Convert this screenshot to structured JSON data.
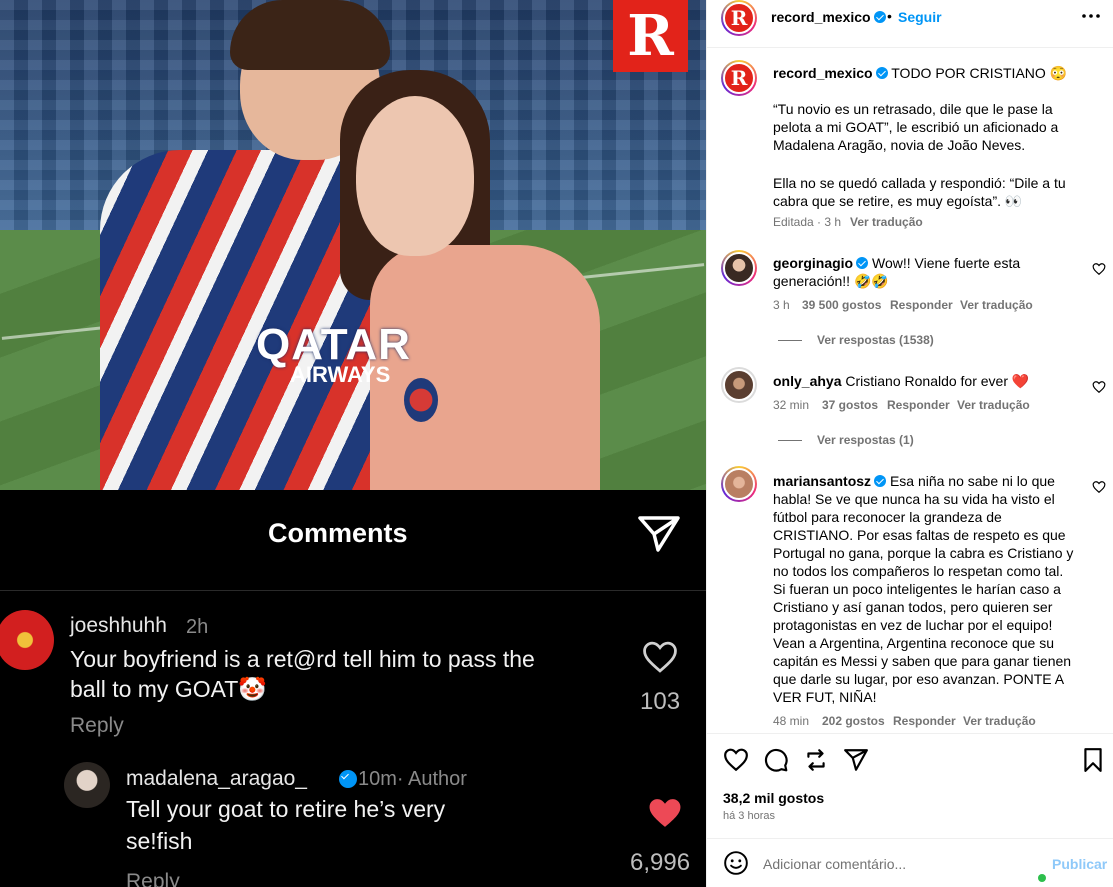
{
  "media": {
    "brand_mark": "R",
    "jersey_sponsor": "QATAR",
    "jersey_sponsor_sub": "AIRWAYS",
    "comments_title": "Comments",
    "comments": [
      {
        "user": "joeshhuhh",
        "time": "2h",
        "text_line1": "Your boyfriend is a ret@rd tell him to pass the",
        "text_line2": "ball to my GOAT🤡",
        "reply": "Reply",
        "likes": "103"
      },
      {
        "user": "madalena_aragao_",
        "time": "10m· Author",
        "text_line1": "Tell your goat to retire he’s very",
        "text_line2": "se!fish",
        "reply": "Reply",
        "likes": "6,996"
      }
    ]
  },
  "header": {
    "username": "record_mexico",
    "dot": "•",
    "follow": "Seguir",
    "more_icon": "more-horizontal-icon"
  },
  "caption": {
    "username": "record_mexico",
    "title": "TODO POR CRISTIANO 😳",
    "para1": "“Tu novio es un retrasado, dile que le pase la pelota a mi GOAT”, le escribió un aficionado a Madalena Aragão, novia de João Neves.",
    "para2": "Ella no se quedó callada y respondió: “Dile a tu cabra que se retire, es muy egoísta”. 👀",
    "edited": "Editada · 3 h",
    "translate": "Ver tradução"
  },
  "comments": [
    {
      "username": "georginagio",
      "text": "Wow!! Viene fuerte esta generación!! 🤣🤣",
      "time": "3 h",
      "likes": "39 500 gostos",
      "reply": "Responder",
      "translate": "Ver tradução",
      "view_replies": "Ver respostas (1538)"
    },
    {
      "username": "only_ahya",
      "text": "Cristiano Ronaldo for ever ❤️",
      "time": "32 min",
      "likes": "37 gostos",
      "reply": "Responder",
      "translate": "Ver tradução",
      "view_replies": "Ver respostas (1)"
    },
    {
      "username": "mariansantosz",
      "text": "Esa niña no sabe ni lo que habla! Se ve que nunca ha su vida ha visto el fútbol para reconocer la grandeza de CRISTIANO. Por esas faltas de respeto es que Portugal no gana, porque la cabra es Cristiano y no todos los compañeros lo respetan como tal. Si fueran un poco inteligentes le harían caso a Cristiano y así ganan todos, pero quieren ser protagonistas en vez de luchar por el equipo! Vean a Argentina, Argentina reconoce que su capitán es Messi y saben que para ganar tienen que darle su lugar, por eso avanzan. PONTE A VER FUT, NIÑA!",
      "time": "48 min",
      "likes": "202 gostos",
      "reply": "Responder",
      "translate": "Ver tradução"
    }
  ],
  "footer": {
    "likes": "38,2 mil gostos",
    "posted": "há 3 horas",
    "input_placeholder": "Adicionar comentário...",
    "publish": "Publicar"
  },
  "colors": {
    "accent": "#0095f6",
    "brand_red": "#e2231a",
    "heart_red": "#ed4956"
  }
}
